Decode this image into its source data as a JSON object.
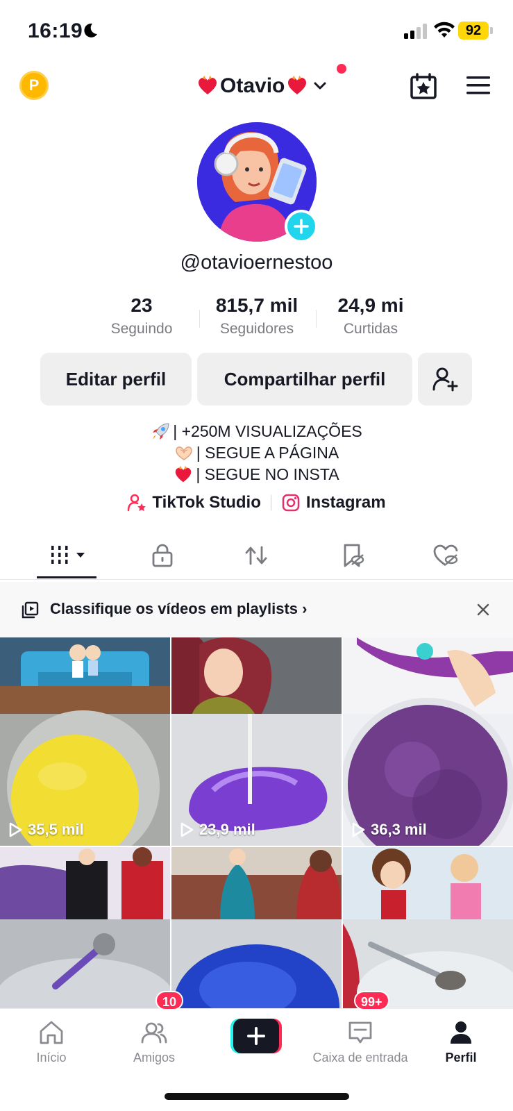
{
  "status_bar": {
    "time": "16:19",
    "battery": "92"
  },
  "header": {
    "username_display": "Otavio",
    "coin_label": "P"
  },
  "profile": {
    "handle": "@otavioernestoo"
  },
  "stats": [
    {
      "value": "23",
      "label": "Seguindo"
    },
    {
      "value": "815,7 mil",
      "label": "Seguidores"
    },
    {
      "value": "24,9 mi",
      "label": "Curtidas"
    }
  ],
  "buttons": {
    "edit": "Editar perfil",
    "share": "Compartilhar perfil"
  },
  "bio": [
    "| +250M VISUALIZAÇÕES",
    "| SEGUE A PÁGINA",
    "| SEGUE NO INSTA"
  ],
  "links": {
    "studio": "TikTok Studio",
    "instagram": "Instagram"
  },
  "playlist_banner": {
    "text": "Classifique os vídeos em playlists"
  },
  "videos": [
    {
      "views": "35,5 mil"
    },
    {
      "views": "23,9 mil"
    },
    {
      "views": "36,3 mil"
    }
  ],
  "bottom_nav": {
    "home": "Início",
    "friends": "Amigos",
    "friends_badge": "10",
    "inbox": "Caixa de entrada",
    "inbox_badge": "99+",
    "profile": "Perfil"
  },
  "colors": {
    "accent": "#fe2c55",
    "cyan": "#20d5ec",
    "battery": "#ffd60a",
    "coin": "#ffb800"
  }
}
